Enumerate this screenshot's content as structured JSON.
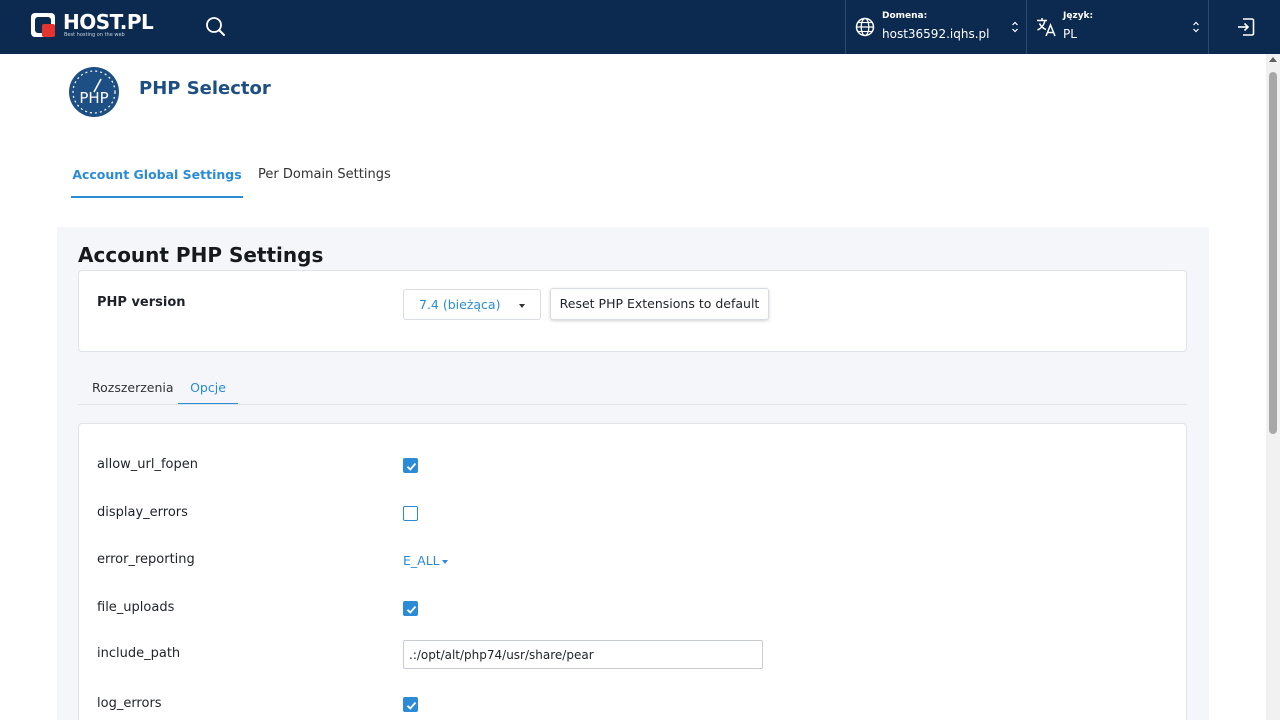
{
  "topbar": {
    "brand": "HOST.PL",
    "tagline": "Best hosting on the web",
    "domain_label": "Domena:",
    "domain_value": "host36592.iqhs.pl",
    "language_label": "Język:",
    "language_value": "PL"
  },
  "header": {
    "logo_text": "PHP",
    "title": "PHP Selector"
  },
  "main_tabs": [
    {
      "label": "Account Global Settings",
      "active": true
    },
    {
      "label": "Per Domain Settings",
      "active": false
    }
  ],
  "section": {
    "title": "Account PHP Settings",
    "php_version_label": "PHP version",
    "php_version_value": "7.4 (bieżąca)",
    "reset_button": "Reset PHP Extensions to default"
  },
  "sub_tabs": [
    {
      "label": "Rozszerzenia",
      "active": false
    },
    {
      "label": "Opcje",
      "active": true
    }
  ],
  "options": [
    {
      "name": "allow_url_fopen",
      "type": "checkbox",
      "checked": true
    },
    {
      "name": "display_errors",
      "type": "checkbox",
      "checked": false
    },
    {
      "name": "error_reporting",
      "type": "dropdown",
      "value": "E_ALL"
    },
    {
      "name": "file_uploads",
      "type": "checkbox",
      "checked": true
    },
    {
      "name": "include_path",
      "type": "text",
      "value": ".:/opt/alt/php74/usr/share/pear"
    },
    {
      "name": "log_errors",
      "type": "checkbox",
      "checked": true
    }
  ],
  "colors": {
    "topbar": "#0c2a4f",
    "accent": "#2b8bd6",
    "title": "#1d4f84",
    "logo_red": "#e3342f",
    "php_logo_bg": "#1d4f84"
  }
}
